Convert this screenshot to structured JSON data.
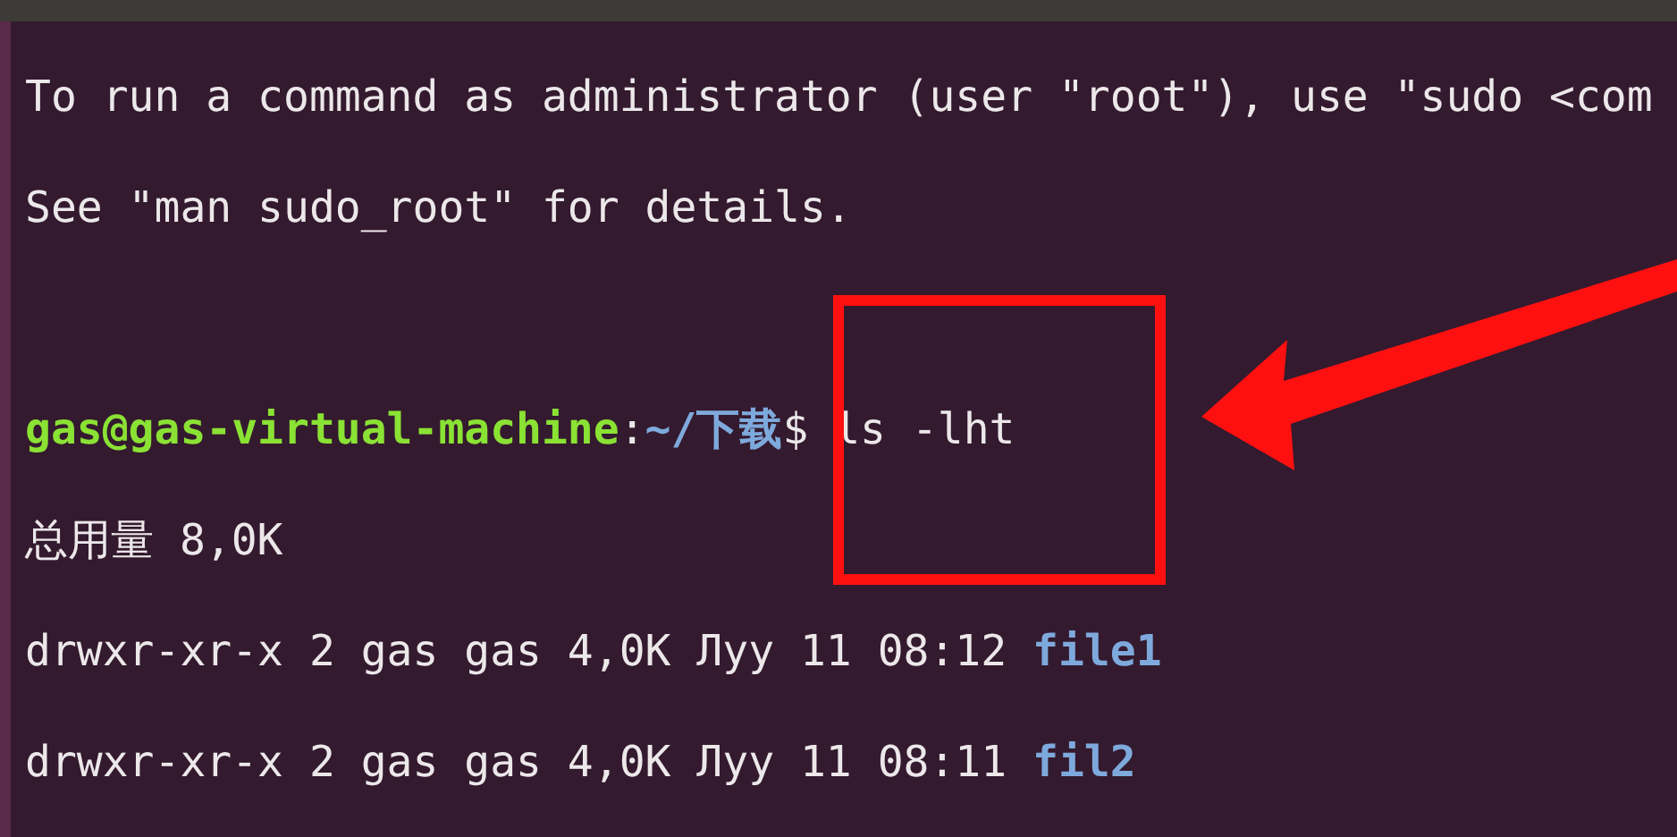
{
  "terminal": {
    "lines": [
      {
        "kind": "output",
        "text": "To run a command as administrator (user \"root\"), use \"sudo <com"
      },
      {
        "kind": "output",
        "text": "See \"man sudo_root\" for details."
      },
      {
        "kind": "prompt",
        "user_host": "gas@gas-virtual-machine",
        "separator": ":",
        "path": "~/下载",
        "symbol": "$",
        "command": "ls -lht"
      },
      {
        "kind": "output",
        "text": "总用量 8,0K"
      },
      {
        "kind": "entry",
        "info": "drwxr-xr-x 2 gas gas 4,0K Луу 11 08:12",
        "name": "file1"
      },
      {
        "kind": "entry",
        "info": "drwxr-xr-x 2 gas gas 4,0K Луу 11 08:11",
        "name": "fil2"
      }
    ]
  }
}
